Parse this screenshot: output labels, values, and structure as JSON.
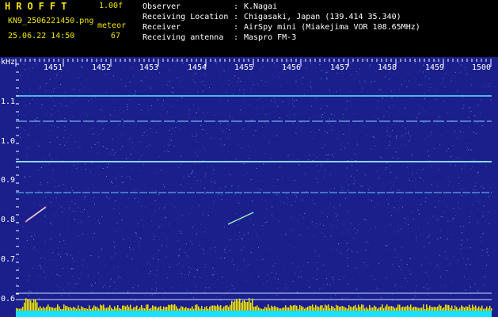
{
  "header": {
    "app_title": "HROFFT",
    "version": "1.00f",
    "filename": "KN9_2506221450.png",
    "datetime": "25.06.22 14:50",
    "meteor_label": "meteor",
    "meteor_count": "67",
    "info": [
      {
        "key": "Observer",
        "value": "K.Nagai"
      },
      {
        "key": "Receiving Location",
        "value": "Chigasaki, Japan (139.414 35.340)"
      },
      {
        "key": "Receiver",
        "value": "AirSpy mini (Miakejima VOR 108.65MHz)"
      },
      {
        "key": "Receiving antenna",
        "value": "Maspro FM-3"
      }
    ]
  },
  "axes": {
    "y_unit": "kHz",
    "y_ticks": [
      "1.1",
      "1.0",
      "0.9",
      "0.8",
      "0.7",
      "0.6"
    ],
    "x_ticks": [
      "1451",
      "1452",
      "1453",
      "1454",
      "1455",
      "1456",
      "1457",
      "1458",
      "1459",
      "1500"
    ]
  },
  "colors": {
    "label_yellow": "#f2e600",
    "background_blue": "#1a1f8c",
    "carrier_cyan": "#5fe8ff",
    "bottom_bar": "#18e0ff"
  }
}
